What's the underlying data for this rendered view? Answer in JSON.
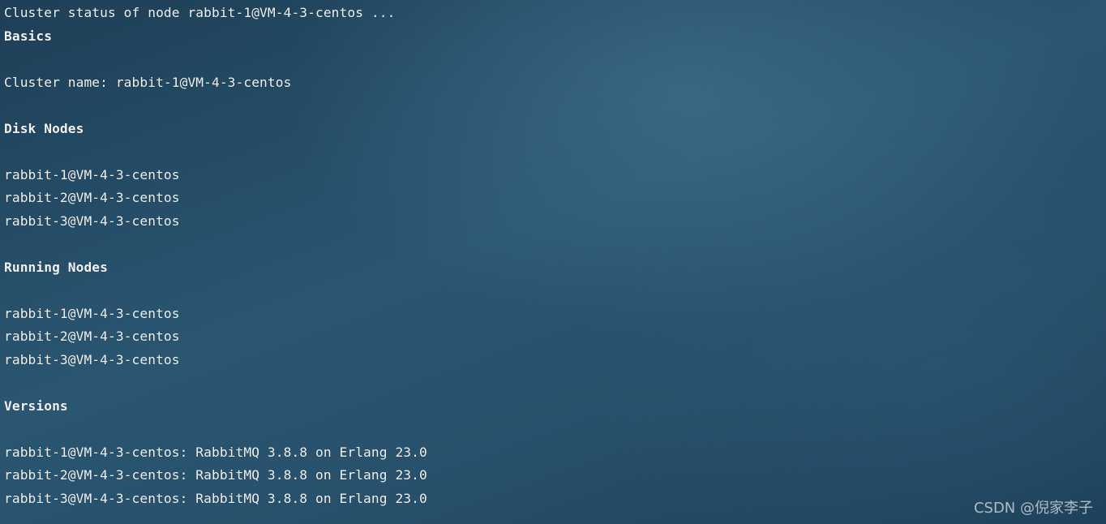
{
  "terminal": {
    "lines": [
      {
        "text": "Cluster status of node rabbit-1@VM-4-3-centos ...",
        "bold": false
      },
      {
        "text": "Basics",
        "bold": true
      },
      {
        "text": "",
        "bold": false
      },
      {
        "text": "Cluster name: rabbit-1@VM-4-3-centos",
        "bold": false
      },
      {
        "text": "",
        "bold": false
      },
      {
        "text": "Disk Nodes",
        "bold": true
      },
      {
        "text": "",
        "bold": false
      },
      {
        "text": "rabbit-1@VM-4-3-centos",
        "bold": false
      },
      {
        "text": "rabbit-2@VM-4-3-centos",
        "bold": false
      },
      {
        "text": "rabbit-3@VM-4-3-centos",
        "bold": false
      },
      {
        "text": "",
        "bold": false
      },
      {
        "text": "Running Nodes",
        "bold": true
      },
      {
        "text": "",
        "bold": false
      },
      {
        "text": "rabbit-1@VM-4-3-centos",
        "bold": false
      },
      {
        "text": "rabbit-2@VM-4-3-centos",
        "bold": false
      },
      {
        "text": "rabbit-3@VM-4-3-centos",
        "bold": false
      },
      {
        "text": "",
        "bold": false
      },
      {
        "text": "Versions",
        "bold": true
      },
      {
        "text": "",
        "bold": false
      },
      {
        "text": "rabbit-1@VM-4-3-centos: RabbitMQ 3.8.8 on Erlang 23.0",
        "bold": false
      },
      {
        "text": "rabbit-2@VM-4-3-centos: RabbitMQ 3.8.8 on Erlang 23.0",
        "bold": false
      },
      {
        "text": "rabbit-3@VM-4-3-centos: RabbitMQ 3.8.8 on Erlang 23.0",
        "bold": false
      }
    ]
  },
  "watermark": {
    "text": "CSDN @倪家李子"
  },
  "colors": {
    "text": "#f2f2f2",
    "background": "#27506b"
  }
}
